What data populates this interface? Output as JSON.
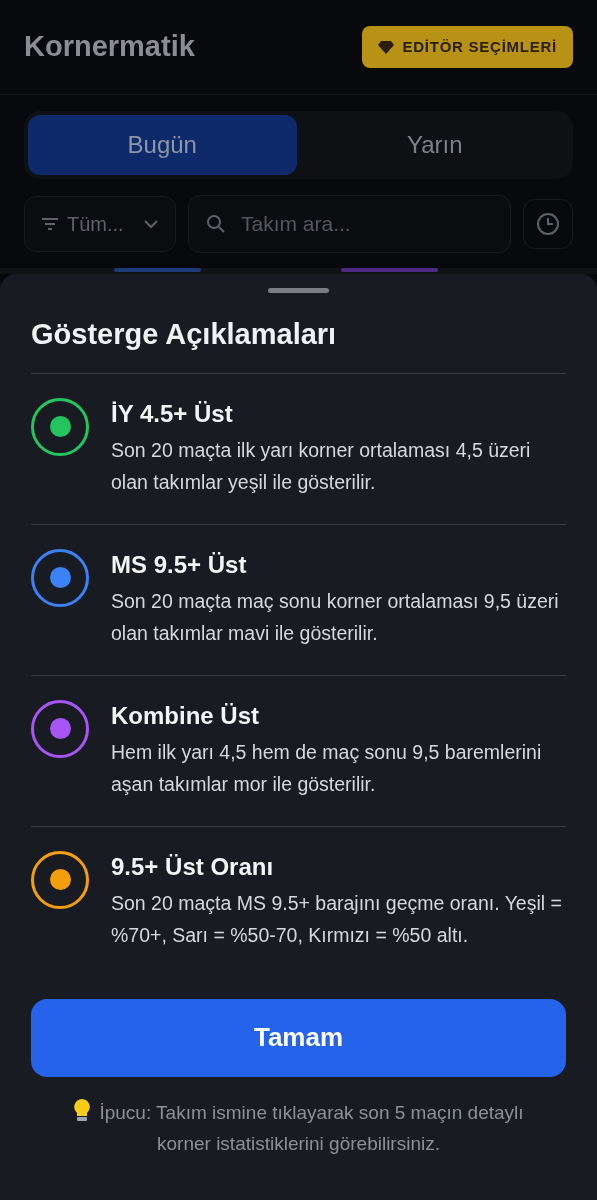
{
  "header": {
    "title": "Kornermatik",
    "editor_button": "EDİTÖR SEÇİMLERİ"
  },
  "tabs": [
    {
      "label": "Bugün",
      "selected": true
    },
    {
      "label": "Yarın",
      "selected": false
    }
  ],
  "filter": {
    "value": "Tüm..."
  },
  "search": {
    "placeholder": "Takım ara..."
  },
  "sheet": {
    "title": "Gösterge Açıklamaları",
    "items": [
      {
        "title": "İY 4.5+ Üst",
        "description": "Son 20 maçta ilk yarı korner ortalaması 4,5 üzeri olan takımlar yeşil ile gösterilir.",
        "color": "#22c55e"
      },
      {
        "title": "MS 9.5+ Üst",
        "description": "Son 20 maçta maç sonu korner ortalaması 9,5 üzeri olan takımlar mavi ile gösterilir.",
        "color": "#3b82f6"
      },
      {
        "title": "Kombine Üst",
        "description": "Hem ilk yarı 4,5 hem de maç sonu 9,5 baremlerini aşan takımlar mor ile gösterilir.",
        "color": "#a855f7"
      },
      {
        "title": "9.5+ Üst Oranı",
        "description": "Son 20 maçta MS 9.5+ barajını geçme oranı. Yeşil = %70+, Sarı = %50-70, Kırmızı = %50 altı.",
        "color": "#f59e0b"
      }
    ],
    "button": "Tamam",
    "tip": "İpucu: Takım ismine tıklayarak son 5 maçın detaylı korner istatistiklerini görebilirsiniz."
  }
}
